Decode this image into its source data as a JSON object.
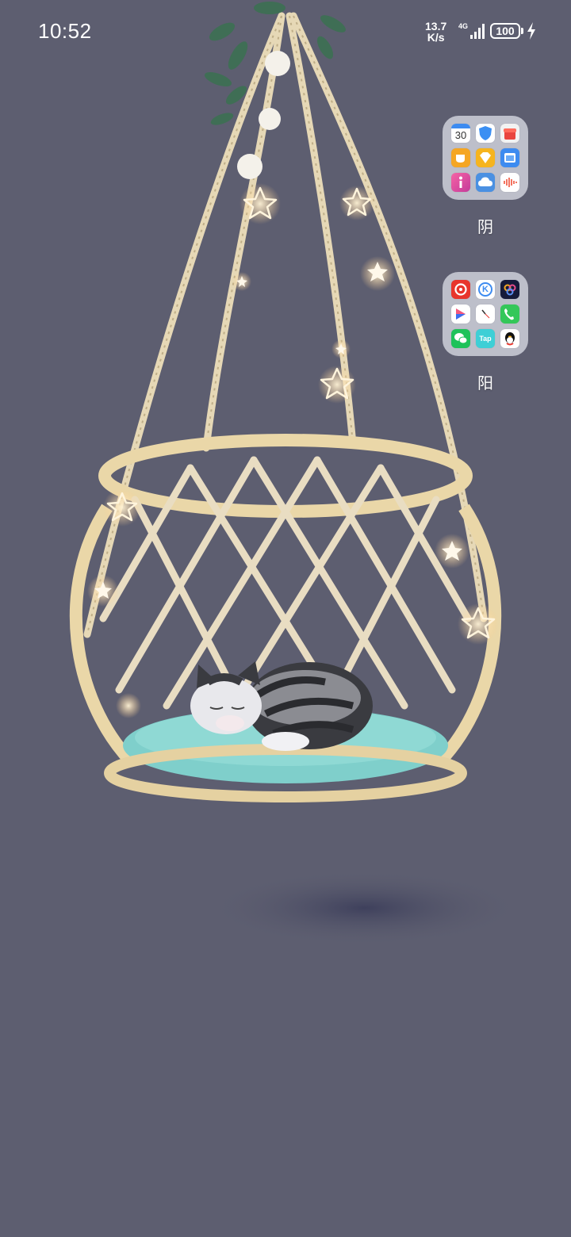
{
  "status_bar": {
    "time": "10:52",
    "net_speed_value": "13.7",
    "net_speed_unit": "K/s",
    "network_type": "4G",
    "battery": "100"
  },
  "folders": [
    {
      "label": "阴",
      "apps": [
        {
          "icon": "calendar-icon",
          "text": "30",
          "color": "#ffffff"
        },
        {
          "icon": "shield-icon",
          "color": "#ffffff"
        },
        {
          "icon": "gift-box-icon",
          "color": "#f2f2f2"
        },
        {
          "icon": "cup-icon",
          "color": "#f5a623"
        },
        {
          "icon": "diamond-icon",
          "color": "#f6b41e"
        },
        {
          "icon": "window-icon",
          "color": "#3d8bf0"
        },
        {
          "icon": "info-icon",
          "color": "#e94d8c"
        },
        {
          "icon": "cloud-icon",
          "color": "#4a90e2"
        },
        {
          "icon": "soundwave-icon",
          "color": "#ffffff"
        }
      ]
    },
    {
      "label": "阳",
      "apps": [
        {
          "icon": "music-disc-icon",
          "color": "#e8352c"
        },
        {
          "icon": "k-letter-icon",
          "text": "K",
          "color": "#ffffff"
        },
        {
          "icon": "infinity-icon",
          "color": "#161a3a"
        },
        {
          "icon": "play-shape-icon",
          "color": "#ffffff"
        },
        {
          "icon": "clock-icon",
          "color": "#ffffff"
        },
        {
          "icon": "phone-icon",
          "color": "#34c759"
        },
        {
          "icon": "wechat-icon",
          "color": "#1ec25a"
        },
        {
          "icon": "tap-icon",
          "text": "Tap",
          "color": "#3ecfd6"
        },
        {
          "icon": "penguin-icon",
          "color": "#ffffff"
        }
      ]
    }
  ]
}
